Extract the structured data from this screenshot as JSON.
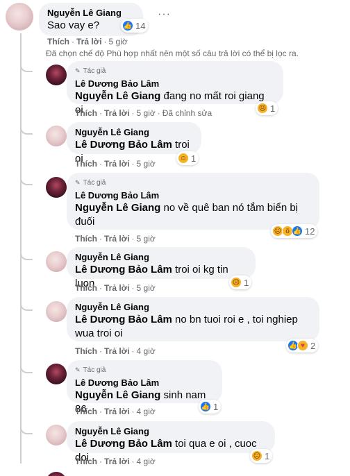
{
  "root": {
    "name": "Nguyễn Lê Giang",
    "text": "Sao vay e?",
    "reactions_count": "14",
    "actions": {
      "like": "Thích",
      "reply": "Trả lời",
      "time": "5 giờ"
    },
    "more_icon": "ellipsis-icon"
  },
  "filter_note": "Đã chọn chế độ Phù hợp nhất nên một số câu trả lời có thể bị lọc ra.",
  "author_badge": "Tác giả",
  "replies": [
    {
      "name": "Lê Dương Bảo Lâm",
      "author": true,
      "mention": "Nguyễn Lê Giang",
      "text": "đang no mất roi giang oi",
      "like": "Thích",
      "reply": "Trả lời",
      "time": "5 giờ",
      "extra": "Đã chỉnh sửa",
      "reactions": [
        "sad"
      ],
      "count": "1"
    },
    {
      "name": "Nguyễn Lê Giang",
      "author": false,
      "mention": "Lê Dương Bảo Lâm",
      "text": "troi oi",
      "like": "Thích",
      "reply": "Trả lời",
      "time": "5 giờ",
      "reactions": [
        "haha"
      ],
      "count": "1"
    },
    {
      "name": "Lê Dương Bảo Lâm",
      "author": true,
      "mention": "Nguyễn Lê Giang",
      "text": "no về quê ban nó tắm biển bị",
      "text2": "đuối",
      "like": "Thích",
      "reply": "Trả lời",
      "time": "5 giờ",
      "reactions": [
        "sad",
        "wow",
        "like"
      ],
      "count": "12"
    },
    {
      "name": "Nguyễn Lê Giang",
      "author": false,
      "mention": "Lê Dương Bảo Lâm",
      "text": "troi oi kg tin luon",
      "like": "Thích",
      "reply": "Trả lời",
      "time": "5 giờ",
      "reactions": [
        "sad"
      ],
      "count": "1"
    },
    {
      "name": "Nguyễn Lê Giang",
      "author": false,
      "mention": "Lê Dương Bảo Lâm",
      "text": "no bn tuoi roi e , toi nghiep",
      "text2": "wua troi oi",
      "like": "Thích",
      "reply": "Trả lời",
      "time": "4 giờ",
      "reactions": [
        "like",
        "care"
      ],
      "count": "2"
    },
    {
      "name": "Lê Dương Bảo Lâm",
      "author": true,
      "mention": "Nguyễn Lê Giang",
      "text": "sinh nam 86",
      "like": "Thích",
      "reply": "Trả lời",
      "time": "4 giờ",
      "reactions": [
        "like"
      ],
      "count": "1"
    },
    {
      "name": "Nguyễn Lê Giang",
      "author": false,
      "mention": "Lê Dương Bảo Lâm",
      "text": "toi qua e oi , cuoc doi",
      "like": "Thích",
      "reply": "Trả lời",
      "time": "4 giờ",
      "reactions": [
        "sad"
      ],
      "count": "1"
    }
  ]
}
